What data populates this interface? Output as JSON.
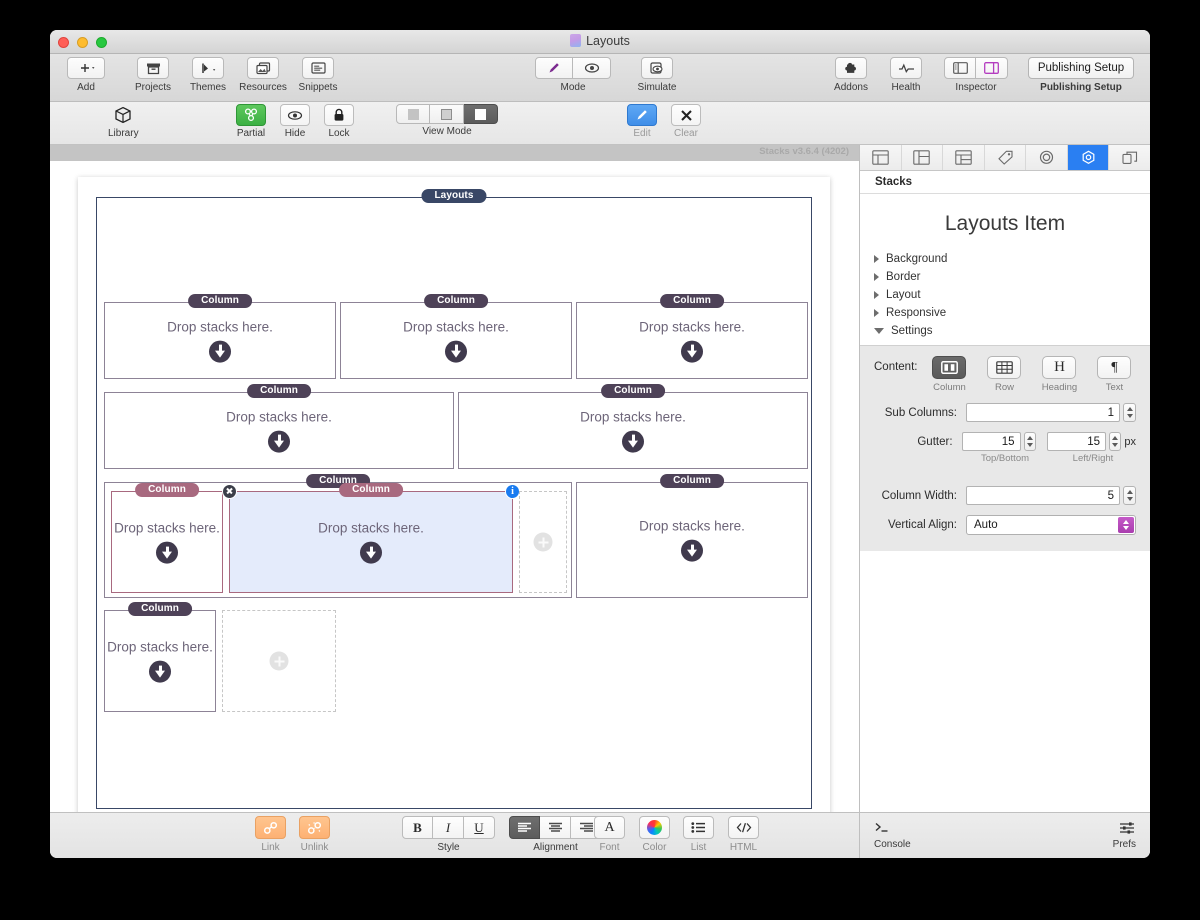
{
  "window": {
    "title": "Layouts",
    "doc_icon": "document-icon"
  },
  "toolbar_top": {
    "left_items": [
      {
        "name": "add",
        "label": "Add",
        "icon": "plus-icon"
      },
      {
        "name": "projects",
        "label": "Projects",
        "icon": "archive-box-icon"
      },
      {
        "name": "themes",
        "label": "Themes",
        "icon": "theme-brush-icon"
      },
      {
        "name": "resources",
        "label": "Resources",
        "icon": "photos-stack-icon"
      },
      {
        "name": "snippets",
        "label": "Snippets",
        "icon": "snippet-window-icon"
      }
    ],
    "center_items": [
      {
        "name": "mode",
        "label": "Mode",
        "icons": [
          "pencil-icon",
          "eye-icon"
        ]
      },
      {
        "name": "simulate",
        "label": "Simulate",
        "icon": "simulate-eye-icon"
      }
    ],
    "right_items": [
      {
        "name": "addons",
        "label": "Addons",
        "icon": "puzzle-icon"
      },
      {
        "name": "health",
        "label": "Health",
        "icon": "pulse-icon"
      },
      {
        "name": "inspector",
        "label": "Inspector",
        "icons": [
          "left-panel-icon",
          "right-panel-icon"
        ]
      }
    ],
    "publishing_setup": {
      "button_label": "Publishing Setup",
      "caption": "Publishing Setup"
    }
  },
  "toolbar_second": {
    "library": {
      "label": "Library",
      "icon": "cube-icon"
    },
    "partial": {
      "label": "Partial",
      "icon": "stacks-icon",
      "active": true
    },
    "hide": {
      "label": "Hide",
      "icon": "eye-icon"
    },
    "lock": {
      "label": "Lock",
      "icon": "lock-icon"
    },
    "view_mode": {
      "label": "View Mode",
      "segments": [
        "plain",
        "outline",
        "filled"
      ],
      "selected_index": 2
    },
    "edit": {
      "label": "Edit",
      "icon": "pencil-icon"
    },
    "clear": {
      "label": "Clear",
      "icon": "x-icon"
    }
  },
  "canvas": {
    "version": "Stacks v3.6.4 (4202)",
    "root_label": "Layouts",
    "drop_text": "Drop stacks here.",
    "column_label": "Column",
    "rows": [
      {
        "name": "row-1",
        "columns": [
          "Column",
          "Column",
          "Column"
        ]
      },
      {
        "name": "row-2",
        "columns": [
          "Column",
          "Column"
        ]
      },
      {
        "name": "row-3",
        "columns": [
          "Column",
          "Column"
        ]
      },
      {
        "name": "row-4",
        "columns": [
          "Column"
        ]
      }
    ],
    "selected": {
      "label": "Column",
      "close_badge": "x-icon",
      "info_badge": "i"
    }
  },
  "inspector": {
    "tabs": [
      {
        "name": "page-tab",
        "icon": "page-layout-icon",
        "active": false
      },
      {
        "name": "master-tab",
        "icon": "master-layout-icon",
        "active": false
      },
      {
        "name": "site-tab",
        "icon": "site-layout-icon",
        "active": false
      },
      {
        "name": "tags-tab",
        "icon": "tag-icon",
        "active": false
      },
      {
        "name": "style-tab",
        "icon": "circle-target-icon",
        "active": false
      },
      {
        "name": "settings-tab",
        "icon": "hex-gear-icon",
        "active": true
      },
      {
        "name": "detach-tab",
        "icon": "detach-window-icon",
        "active": false
      }
    ],
    "subheader": "Stacks",
    "title": "Layouts Item",
    "sections": [
      {
        "label": "Background",
        "open": false
      },
      {
        "label": "Border",
        "open": false
      },
      {
        "label": "Layout",
        "open": false
      },
      {
        "label": "Responsive",
        "open": false
      },
      {
        "label": "Settings",
        "open": true
      }
    ],
    "settings": {
      "content_label": "Content:",
      "content_options": [
        {
          "label": "Column",
          "icon": "column-icon",
          "selected": true
        },
        {
          "label": "Row",
          "icon": "grid-icon",
          "selected": false
        },
        {
          "label": "Heading",
          "icon": "heading-h-icon",
          "selected": false
        },
        {
          "label": "Text",
          "icon": "pilcrow-icon",
          "selected": false
        }
      ],
      "sub_columns_label": "Sub Columns:",
      "sub_columns_value": "1",
      "gutter_label": "Gutter:",
      "gutter_top_bottom_value": "15",
      "gutter_left_right_value": "15",
      "gutter_unit": "px",
      "gutter_caption_left": "Top/Bottom",
      "gutter_caption_right": "Left/Right",
      "column_width_label": "Column Width:",
      "column_width_value": "5",
      "vertical_align_label": "Vertical Align:",
      "vertical_align_value": "Auto"
    }
  },
  "bottom_bar": {
    "link": {
      "label": "Link",
      "icon": "link-icon"
    },
    "unlink": {
      "label": "Unlink",
      "icon": "unlink-icon"
    },
    "style": {
      "label": "Style",
      "buttons": [
        "B",
        "I",
        "U"
      ]
    },
    "alignment": {
      "label": "Alignment",
      "options": [
        "align-left-icon",
        "align-center-icon",
        "align-right-icon"
      ],
      "selected_index": 0
    },
    "font": {
      "label": "Font",
      "icon": "font-a-icon"
    },
    "color": {
      "label": "Color",
      "icon": "color-wheel-icon"
    },
    "list": {
      "label": "List",
      "icon": "bullet-list-icon"
    },
    "html": {
      "label": "HTML",
      "icon": "code-icon"
    },
    "console": {
      "label": "Console",
      "icon": "terminal-prompt-icon"
    },
    "prefs": {
      "label": "Prefs",
      "icon": "sliders-icon"
    }
  },
  "colors": {
    "accent_blue": "#2a7ff2",
    "root_frame": "#394766",
    "column_pill": "#4e4258",
    "selected_pill": "#a8697f",
    "selection_fill": "#e4ebfb",
    "green_active": "#3cb043",
    "magenta": "#a93dae"
  }
}
